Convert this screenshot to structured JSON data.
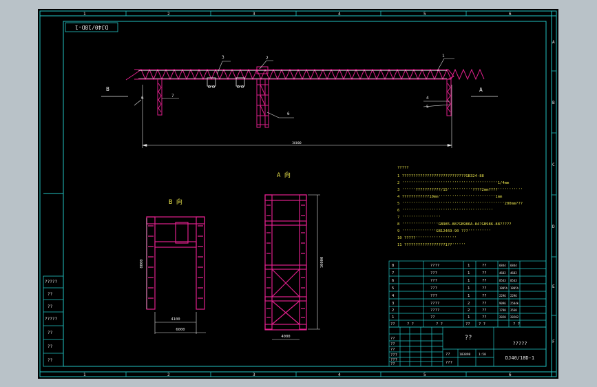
{
  "colors": {
    "frame": "#22c5c5",
    "steel": "#e0208c",
    "dim": "#e8e8e8",
    "note": "#e6e04a",
    "background": "#000000",
    "outer": "#b9c2c8"
  },
  "drawing_no_rotated": "DJ40/18D-1",
  "grid_top": [
    "1",
    "2",
    "3",
    "4",
    "5",
    "6"
  ],
  "grid_bottom": [
    "1",
    "2",
    "3",
    "4",
    "5",
    "6"
  ],
  "grid_right": [
    "A",
    "B",
    "C",
    "D",
    "E",
    "F"
  ],
  "elevation": {
    "view_b_marker": "B",
    "view_a_marker": "A",
    "balloons": [
      "1",
      "2",
      "3",
      "4",
      "5",
      "6",
      "6",
      "7"
    ],
    "span_dim": "36000"
  },
  "view_b": {
    "title": "B 向",
    "width_dim": "4100",
    "outer_width_dim": "6000",
    "height_dim": "8000"
  },
  "view_a": {
    "title": "A 向",
    "height_dim": "10000",
    "width_dim": "4000"
  },
  "notes": {
    "heading": "?????",
    "lines": [
      "1 ????????????????????????????GB324-88",
      "2 ''''''''''''''''''''''''''''''''''''''''''1/4mm",
      "3 ''''''???????????/15'''''''''''????2mm????'''''''''''",
      "4 ????????????10mm'''''''''''''''''''''''''1mm",
      "5 '''''''''''''''''''''''''''''''''''''''''''''200mm???",
      "6 ''''''''''''''''''''''''''''''''''''''''",
      "7 '''''''''''''''''",
      "8 ''''''''''''''''GB985-88?GB986A-84?GB986-88?????",
      "9 '''''''''''''''GB12469-90 ???''''''''''",
      "10 ?????''''''''''''''''''",
      "11 ??????????????????1??''''''"
    ]
  },
  "bom": {
    "rows": [
      [
        "8",
        "????",
        "1",
        "??",
        "6844",
        "6844"
      ],
      [
        "7",
        "???",
        "1",
        "??",
        "4682",
        "4682"
      ],
      [
        "6",
        "???",
        "1",
        "??",
        "8543",
        "8543"
      ],
      [
        "5",
        "???",
        "1",
        "??",
        "1805h",
        "1805h"
      ],
      [
        "4",
        "???",
        "1",
        "??",
        "2296",
        "2296"
      ],
      [
        "3",
        "????",
        "2",
        "??",
        "9096",
        "2584k"
      ],
      [
        "2",
        "????",
        "2",
        "??",
        "1780",
        "3560"
      ],
      [
        "1",
        "??",
        "1",
        "??",
        "2020",
        "20202"
      ]
    ],
    "header": [
      "??",
      "?  ?",
      "?  ?",
      "??",
      "?  ?",
      "?  ?"
    ]
  },
  "title_block": {
    "title_main": "??",
    "company": "?????",
    "drawing_no": "DJ40/18D-1",
    "scale": "1:50",
    "weight": "183898",
    "sheet_fields": [
      "??",
      "??",
      "??",
      "???",
      "???",
      "??",
      "??",
      "???"
    ]
  },
  "side_table": [
    "?????",
    "??",
    "??",
    "?????",
    "??",
    "??",
    "??"
  ]
}
